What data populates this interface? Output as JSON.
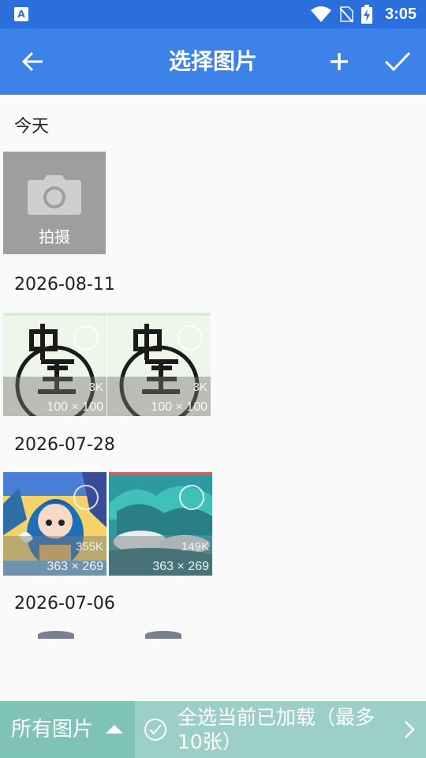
{
  "status_bar": {
    "time": "3:05",
    "icons": [
      "notification-a-icon",
      "wifi-icon",
      "no-sim-icon",
      "battery-charging-icon"
    ]
  },
  "app_bar": {
    "title": "选择图片",
    "back_icon": "arrow-left-icon",
    "add_icon": "plus-icon",
    "confirm_icon": "check-icon"
  },
  "sections": [
    {
      "title": "今天",
      "camera_tile": {
        "label": "拍摄",
        "icon": "camera-icon"
      }
    },
    {
      "title": "2026-08-11",
      "photos": [
        {
          "size": "3K",
          "dims": "100 × 100"
        },
        {
          "size": "3K",
          "dims": "100 × 100"
        }
      ]
    },
    {
      "title": "2026-07-28",
      "photos": [
        {
          "size": "355K",
          "dims": "363 × 269"
        },
        {
          "size": "149K",
          "dims": "363 × 269"
        }
      ]
    },
    {
      "title": "2026-07-06"
    }
  ],
  "bottom_bar": {
    "folder_label": "所有图片",
    "select_all_label": "全选当前已加载（最多10张）"
  },
  "colors": {
    "status_bar": "#2a6fdc",
    "app_bar": "#3d82e8",
    "bottom_bar": "#9ccfc7",
    "folder_button": "#7fc2b8"
  }
}
